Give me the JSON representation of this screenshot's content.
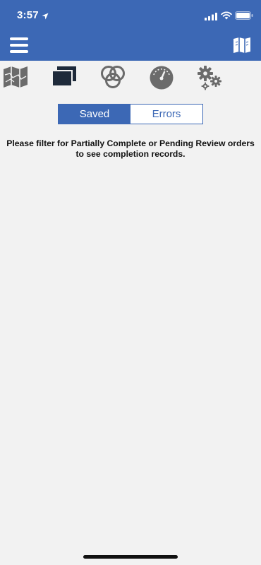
{
  "status_bar": {
    "time": "3:57"
  },
  "icons": {
    "location": "location-arrow-icon",
    "signal": "cellular-signal-icon",
    "wifi": "wifi-icon",
    "battery": "battery-icon",
    "menu": "hamburger-menu-icon",
    "map_book": "map-book-icon",
    "toolbar": [
      "map-icon",
      "layers-icon",
      "venn-circles-icon",
      "gauge-icon",
      "gears-icon"
    ]
  },
  "colors": {
    "accent": "#3c68b5",
    "background": "#f2f2f2",
    "toolbar_icon": "#6b6b6b",
    "toolbar_active_icon": "#1e2a3a"
  },
  "segmented": {
    "saved_label": "Saved",
    "errors_label": "Errors",
    "selected": "Saved"
  },
  "message": "Please filter for Partially Complete or Pending Review orders to see completion records."
}
